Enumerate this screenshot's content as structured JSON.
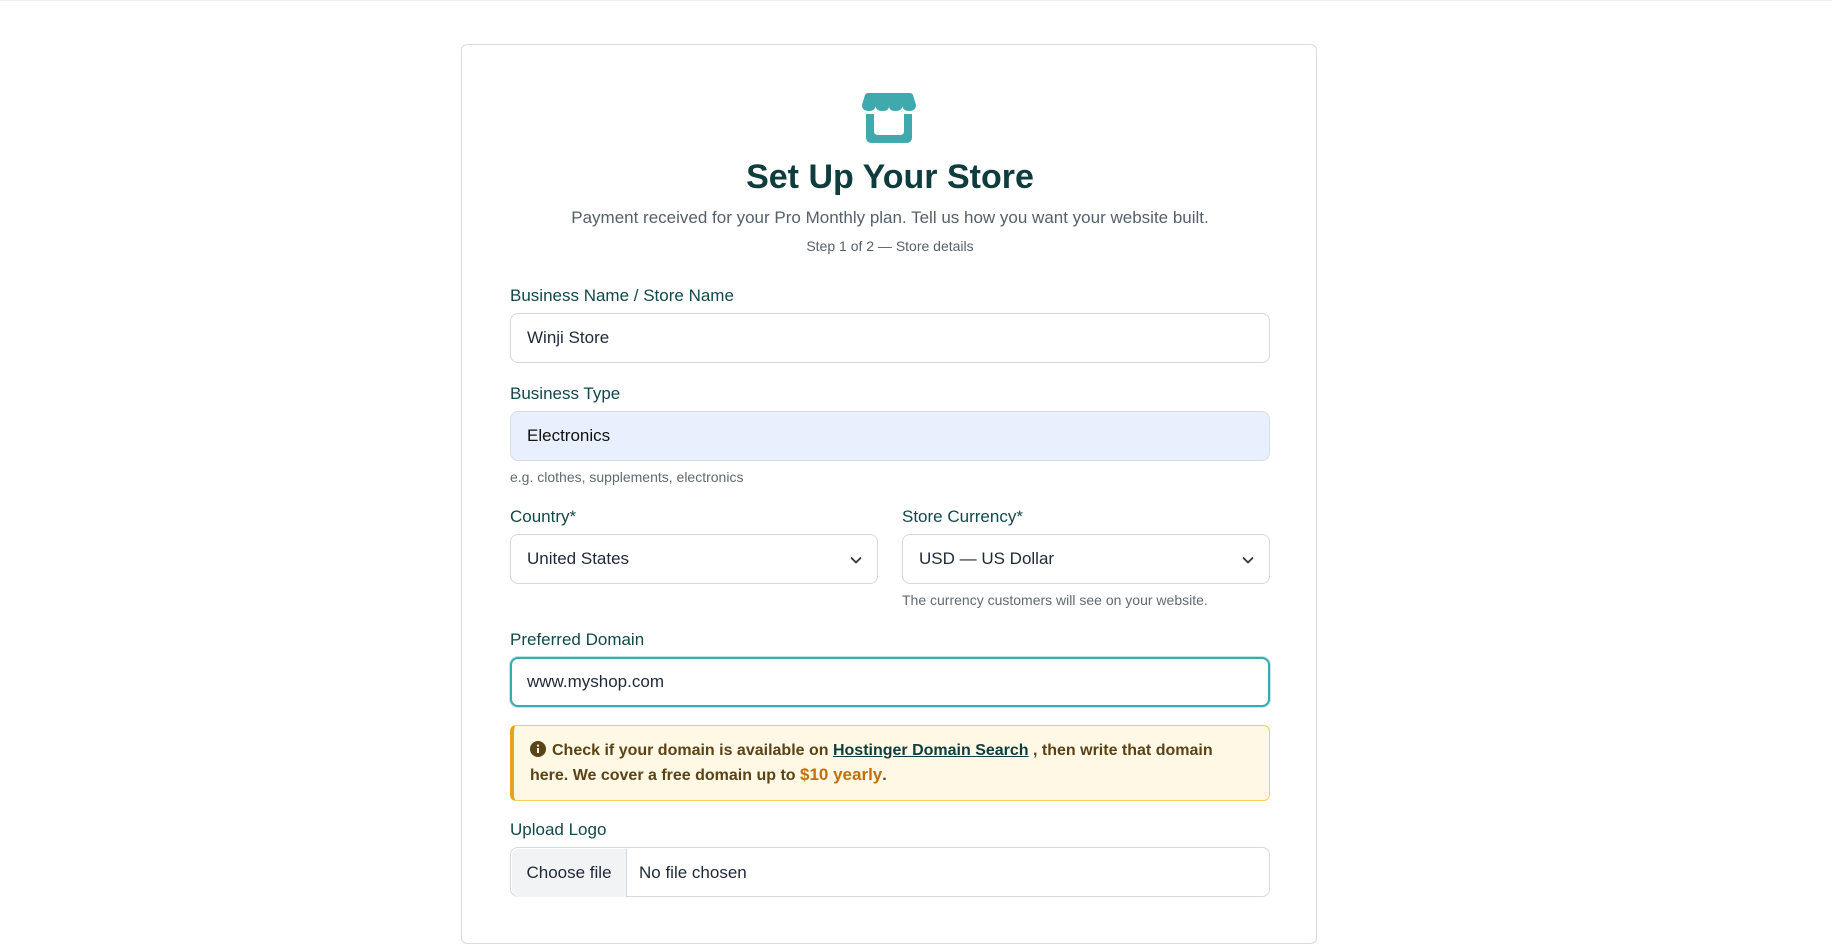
{
  "header": {
    "icon": "storefront-icon",
    "title": "Set Up Your Store",
    "subtitle": "Payment received for your Pro Monthly plan. Tell us how you want your website built.",
    "step": "Step 1 of 2 — Store details"
  },
  "form": {
    "business_name": {
      "label": "Business Name / Store Name",
      "value": "Winji Store"
    },
    "business_type": {
      "label": "Business Type",
      "value": "Electronics",
      "help": "e.g. clothes, supplements, electronics"
    },
    "country": {
      "label": "Country*",
      "value": "United States"
    },
    "currency": {
      "label": "Store Currency*",
      "value": "USD — US Dollar",
      "help": "The currency customers will see on your website."
    },
    "domain": {
      "label": "Preferred Domain",
      "value": "www.myshop.com"
    },
    "notice": {
      "icon": "info-icon",
      "text_before": "Check if your domain is available on ",
      "link": "Hostinger Domain Search",
      "text_middle": " , then write that domain here. We cover a free domain up to ",
      "price": "$10 yearly",
      "text_after": "."
    },
    "logo": {
      "label": "Upload Logo",
      "button": "Choose file",
      "status": "No file chosen"
    }
  },
  "colors": {
    "accent": "#3fa9ad",
    "title": "#0f3d3e",
    "notice_bg": "#fff8e5",
    "notice_border": "#e3a51d",
    "price": "#c0700b"
  }
}
